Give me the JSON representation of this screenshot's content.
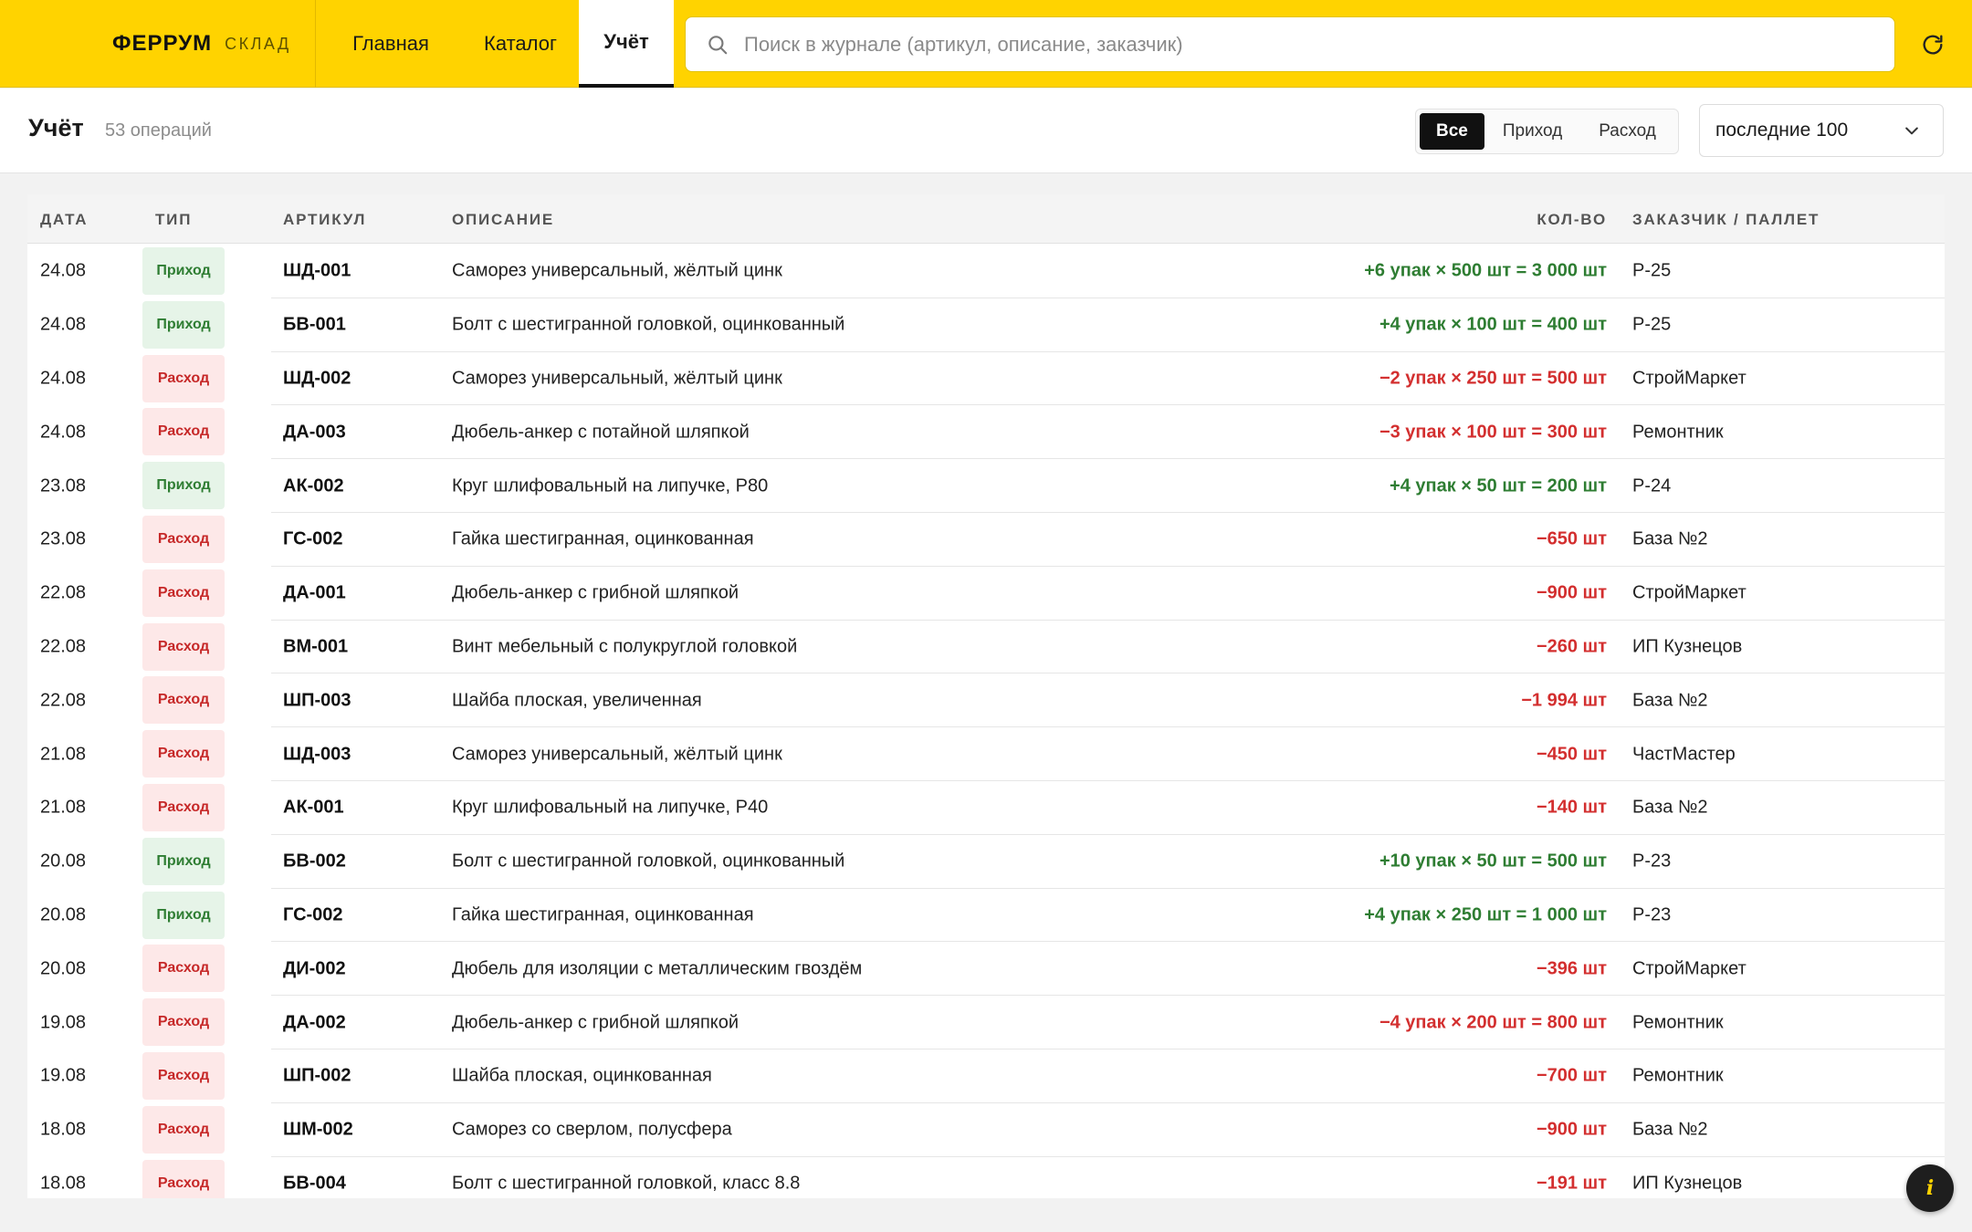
{
  "brand": {
    "name": "ФЕРРУМ",
    "sub": "СКЛАД"
  },
  "nav": {
    "tabs": [
      "Главная",
      "Каталог",
      "Учёт"
    ],
    "active": "Учёт"
  },
  "search": {
    "placeholder": "Поиск в журнале (артикул, описание, заказчик)",
    "value": ""
  },
  "page": {
    "title": "Учёт",
    "count": "53 операций"
  },
  "filter": {
    "segments": [
      "Все",
      "Приход",
      "Расход"
    ],
    "active": "Все",
    "range": "последние 100"
  },
  "table": {
    "headers": {
      "date": "ДАТА",
      "type": "ТИП",
      "sku": "АРТИКУЛ",
      "desc": "ОПИСАНИЕ",
      "qty": "КОЛ-ВО",
      "cust": "ЗАКАЗЧИК / ПАЛЛЕТ"
    },
    "rows": [
      {
        "date": "24.08",
        "type": "Приход",
        "kind": "in",
        "sku": "ШД-001",
        "desc": "Саморез универсальный, жёлтый цинк",
        "qty": "+6 упак × 500 шт = 3 000 шт",
        "cust": "Р-25"
      },
      {
        "date": "24.08",
        "type": "Приход",
        "kind": "in",
        "sku": "БВ-001",
        "desc": "Болт с шестигранной головкой, оцинкованный",
        "qty": "+4 упак × 100 шт = 400 шт",
        "cust": "Р-25"
      },
      {
        "date": "24.08",
        "type": "Расход",
        "kind": "out",
        "sku": "ШД-002",
        "desc": "Саморез универсальный, жёлтый цинк",
        "qty": "−2 упак × 250 шт = 500 шт",
        "cust": "СтройМаркет"
      },
      {
        "date": "24.08",
        "type": "Расход",
        "kind": "out",
        "sku": "ДА-003",
        "desc": "Дюбель-анкер с потайной шляпкой",
        "qty": "−3 упак × 100 шт = 300 шт",
        "cust": "Ремонтник"
      },
      {
        "date": "23.08",
        "type": "Приход",
        "kind": "in",
        "sku": "АК-002",
        "desc": "Круг шлифовальный на липучке, P80",
        "qty": "+4 упак × 50 шт = 200 шт",
        "cust": "Р-24"
      },
      {
        "date": "23.08",
        "type": "Расход",
        "kind": "out",
        "sku": "ГС-002",
        "desc": "Гайка шестигранная, оцинкованная",
        "qty": "−650 шт",
        "cust": "База №2"
      },
      {
        "date": "22.08",
        "type": "Расход",
        "kind": "out",
        "sku": "ДА-001",
        "desc": "Дюбель-анкер с грибной шляпкой",
        "qty": "−900 шт",
        "cust": "СтройМаркет"
      },
      {
        "date": "22.08",
        "type": "Расход",
        "kind": "out",
        "sku": "ВМ-001",
        "desc": "Винт мебельный с полукруглой головкой",
        "qty": "−260 шт",
        "cust": "ИП Кузнецов"
      },
      {
        "date": "22.08",
        "type": "Расход",
        "kind": "out",
        "sku": "ШП-003",
        "desc": "Шайба плоская, увеличенная",
        "qty": "−1 994 шт",
        "cust": "База №2"
      },
      {
        "date": "21.08",
        "type": "Расход",
        "kind": "out",
        "sku": "ШД-003",
        "desc": "Саморез универсальный, жёлтый цинк",
        "qty": "−450 шт",
        "cust": "ЧастМастер"
      },
      {
        "date": "21.08",
        "type": "Расход",
        "kind": "out",
        "sku": "АК-001",
        "desc": "Круг шлифовальный на липучке, P40",
        "qty": "−140 шт",
        "cust": "База №2"
      },
      {
        "date": "20.08",
        "type": "Приход",
        "kind": "in",
        "sku": "БВ-002",
        "desc": "Болт с шестигранной головкой, оцинкованный",
        "qty": "+10 упак × 50 шт = 500 шт",
        "cust": "Р-23"
      },
      {
        "date": "20.08",
        "type": "Приход",
        "kind": "in",
        "sku": "ГС-002",
        "desc": "Гайка шестигранная, оцинкованная",
        "qty": "+4 упак × 250 шт = 1 000 шт",
        "cust": "Р-23"
      },
      {
        "date": "20.08",
        "type": "Расход",
        "kind": "out",
        "sku": "ДИ-002",
        "desc": "Дюбель для изоляции с металлическим гвоздём",
        "qty": "−396 шт",
        "cust": "СтройМаркет"
      },
      {
        "date": "19.08",
        "type": "Расход",
        "kind": "out",
        "sku": "ДА-002",
        "desc": "Дюбель-анкер с грибной шляпкой",
        "qty": "−4 упак × 200 шт = 800 шт",
        "cust": "Ремонтник"
      },
      {
        "date": "19.08",
        "type": "Расход",
        "kind": "out",
        "sku": "ШП-002",
        "desc": "Шайба плоская, оцинкованная",
        "qty": "−700 шт",
        "cust": "Ремонтник"
      },
      {
        "date": "18.08",
        "type": "Расход",
        "kind": "out",
        "sku": "ШМ-002",
        "desc": "Саморез со сверлом, полусфера",
        "qty": "−900 шт",
        "cust": "База №2"
      },
      {
        "date": "18.08",
        "type": "Расход",
        "kind": "out",
        "sku": "БВ-004",
        "desc": "Болт с шестигранной головкой, класс 8.8",
        "qty": "−191 шт",
        "cust": "ИП Кузнецов"
      }
    ]
  },
  "info": {
    "glyph": "i"
  },
  "icons": {
    "search": "search-icon",
    "refresh": "refresh-icon",
    "chevron": "chevron-down-icon",
    "info": "info-icon"
  },
  "colors": {
    "accent": "#ffd300",
    "income": "#2e7d32",
    "expense": "#d32f2f"
  }
}
